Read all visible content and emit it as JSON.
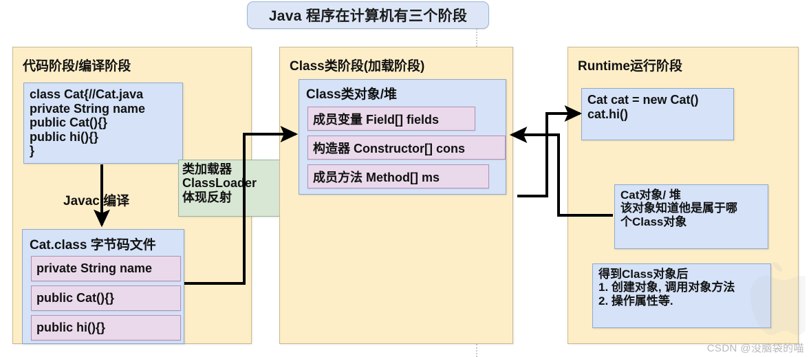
{
  "title": {
    "text": "Java 程序在计算机有三个阶段"
  },
  "stages": {
    "code": {
      "title": "代码阶段/编译阶段",
      "source_box": {
        "lines": [
          "class Cat{//Cat.java",
          "private String name",
          "public Cat(){}",
          "public hi(){}",
          "}"
        ]
      },
      "compile_label": "Javac 编译",
      "class_file_box": {
        "header": "Cat.class 字节码文件",
        "members": [
          "private String name",
          "public Cat(){}",
          "public hi(){}"
        ]
      }
    },
    "classloader": {
      "lines": [
        "类加载器",
        "ClassLoader",
        "体现反射"
      ]
    },
    "class_stage": {
      "title": "Class类阶段(加载阶段)",
      "class_object_box": {
        "header": "Class类对象/堆",
        "members": [
          "成员变量 Field[] fields",
          "构造器 Constructor[] cons",
          "成员方法 Method[] ms"
        ]
      }
    },
    "runtime": {
      "title": "Runtime运行阶段",
      "new_cat_box": {
        "lines": [
          "Cat cat = new Cat()",
          "cat.hi()"
        ]
      },
      "cat_heap_box": {
        "lines": [
          "Cat对象/ 堆",
          "该对象知道他是属于哪",
          "个Class对象"
        ]
      },
      "after_class_box": {
        "lines": [
          "得到Class对象后",
          "1. 创建对象, 调用对象方法",
          "2. 操作属性等."
        ]
      }
    }
  },
  "watermark": {
    "text": "CSDN @没脑袋的喵"
  },
  "colors": {
    "panel_fill": "#fdeec8",
    "panel_border": "#c9b98a",
    "blue_fill": "#d5e2f7",
    "blue_border": "#8fa9cd",
    "lavender_fill": "#ead9ea",
    "lavender_border": "#b28fb4",
    "green_fill": "#d8e6d4",
    "green_border": "#9ab598",
    "arrow": "#000000",
    "watermark": "#b9b9b9"
  }
}
